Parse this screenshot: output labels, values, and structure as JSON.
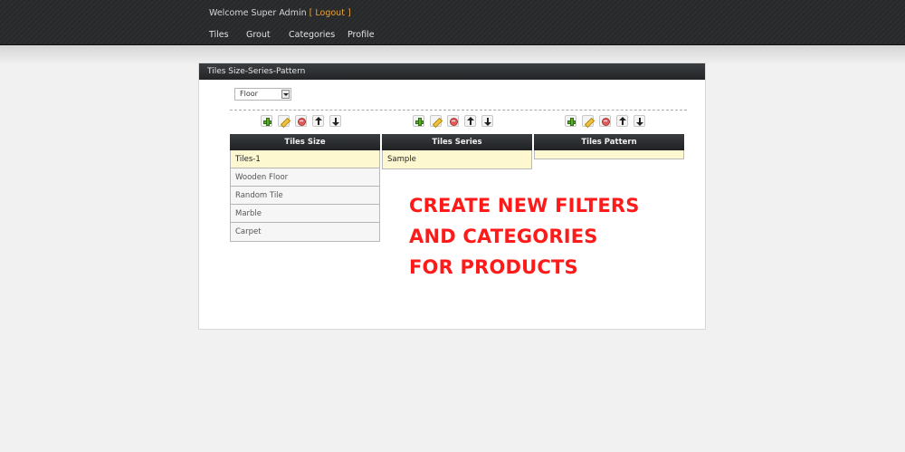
{
  "header": {
    "welcome_text": "Welcome Super Admin",
    "bracket_open": "[",
    "logout_label": "Logout",
    "bracket_close": "]",
    "nav": [
      {
        "label": "Tiles"
      },
      {
        "label": "Grout"
      },
      {
        "label": "Categories"
      },
      {
        "label": "Profile"
      }
    ]
  },
  "panel": {
    "title": "Tiles Size-Series-Pattern",
    "select": {
      "value": "Floor"
    },
    "columns": [
      {
        "header": "Tiles Size",
        "items": [
          "Tiles-1",
          "Wooden Floor",
          "Random Tile",
          "Marble",
          "Carpet"
        ],
        "selected_index": 0
      },
      {
        "header": "Tiles Series",
        "items": [
          "Sample"
        ],
        "selected_index": 0
      },
      {
        "header": "Tiles Pattern",
        "items": [],
        "selected_index": -1
      }
    ]
  },
  "promo": {
    "lines": [
      "CREATE NEW FILTERS",
      "AND CATEGORIES",
      "FOR PRODUCTS"
    ],
    "color": "#ff1a1a"
  },
  "icons": [
    "add-icon",
    "edit-icon",
    "delete-icon",
    "arrow-up-icon",
    "arrow-down-icon"
  ],
  "colors": {
    "header_bg": "#26282a",
    "logout": "#e8a33a",
    "selected_row": "#fdf8cf"
  }
}
